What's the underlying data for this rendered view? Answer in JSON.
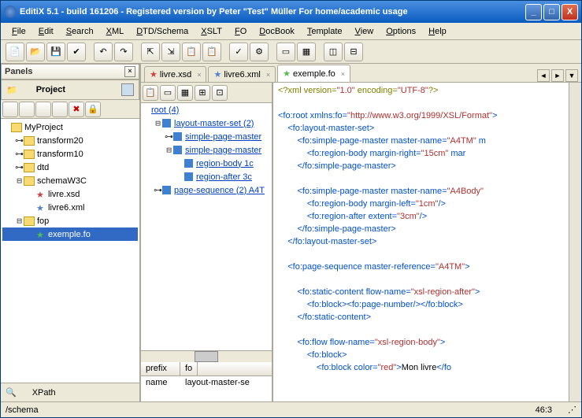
{
  "window": {
    "title": "EditiX 5.1 - build 161206 - Registered version by Peter \"Test\" Müller For home/academic usage"
  },
  "menu": [
    "File",
    "Edit",
    "Search",
    "XML",
    "DTD/Schema",
    "XSLT",
    "FO",
    "DocBook",
    "Template",
    "View",
    "Options",
    "Help"
  ],
  "panels_label": "Panels",
  "project": {
    "title": "Project",
    "tree": [
      {
        "name": "MyProject",
        "depth": 0,
        "type": "folder",
        "toggle": ""
      },
      {
        "name": "transform20",
        "depth": 1,
        "type": "folder",
        "toggle": "⊶"
      },
      {
        "name": "transform10",
        "depth": 1,
        "type": "folder",
        "toggle": "⊶"
      },
      {
        "name": "dtd",
        "depth": 1,
        "type": "folder",
        "toggle": "⊶"
      },
      {
        "name": "schemaW3C",
        "depth": 1,
        "type": "folder",
        "toggle": "⊟"
      },
      {
        "name": "livre.xsd",
        "depth": 2,
        "type": "file",
        "star": "red"
      },
      {
        "name": "livre6.xml",
        "depth": 2,
        "type": "file",
        "star": "blue"
      },
      {
        "name": "fop",
        "depth": 1,
        "type": "folder",
        "toggle": "⊟"
      },
      {
        "name": "exemple.fo",
        "depth": 2,
        "type": "file",
        "star": "green",
        "sel": true
      }
    ]
  },
  "xpath_label": "XPath",
  "tabs": [
    {
      "label": "livre.xsd",
      "star": "red"
    },
    {
      "label": "livre6.xml",
      "star": "blue"
    },
    {
      "label": "exemple.fo",
      "star": "green",
      "active": true
    }
  ],
  "outline": [
    {
      "text": "root (4)",
      "depth": 0,
      "link": true
    },
    {
      "text": "layout-master-set (2)",
      "depth": 1,
      "box": true,
      "link": true,
      "toggle": "⊟"
    },
    {
      "text": "simple-page-master",
      "depth": 2,
      "box": true,
      "link": true,
      "toggle": "⊶"
    },
    {
      "text": "simple-page-master",
      "depth": 2,
      "box": true,
      "link": true,
      "toggle": "⊟"
    },
    {
      "text": "region-body  1c",
      "depth": 3,
      "box": true,
      "link": true
    },
    {
      "text": "region-after  3c",
      "depth": 3,
      "box": true,
      "link": true
    },
    {
      "text": "page-sequence (2)  A4T",
      "depth": 1,
      "box": true,
      "link": true,
      "toggle": "⊶"
    }
  ],
  "prefix_table": {
    "headers": [
      "prefix",
      "fo"
    ],
    "row": [
      "name",
      "layout-master-se"
    ]
  },
  "code_lines": [
    [
      {
        "c": "pi",
        "t": "<?xml version="
      },
      {
        "c": "attr",
        "t": "\"1.0\""
      },
      {
        "c": "pi",
        "t": " encoding="
      },
      {
        "c": "attr",
        "t": "\"UTF-8\""
      },
      {
        "c": "pi",
        "t": "?>"
      }
    ],
    [],
    [
      {
        "c": "tag",
        "t": "<fo:root xmlns:fo="
      },
      {
        "c": "attr",
        "t": "\"http://www.w3.org/1999/XSL/Format\""
      },
      {
        "c": "tag",
        "t": ">"
      }
    ],
    [
      {
        "c": "txt",
        "t": "    "
      },
      {
        "c": "tag",
        "t": "<fo:layout-master-set>"
      }
    ],
    [
      {
        "c": "txt",
        "t": "        "
      },
      {
        "c": "tag",
        "t": "<fo:simple-page-master master-name="
      },
      {
        "c": "attr",
        "t": "\"A4TM\""
      },
      {
        "c": "tag",
        "t": " m"
      }
    ],
    [
      {
        "c": "txt",
        "t": "            "
      },
      {
        "c": "tag",
        "t": "<fo:region-body margin-right="
      },
      {
        "c": "attr",
        "t": "\"15cm\""
      },
      {
        "c": "tag",
        "t": " mar"
      }
    ],
    [
      {
        "c": "txt",
        "t": "        "
      },
      {
        "c": "tag",
        "t": "</fo:simple-page-master>"
      }
    ],
    [],
    [
      {
        "c": "txt",
        "t": "        "
      },
      {
        "c": "tag",
        "t": "<fo:simple-page-master master-name="
      },
      {
        "c": "attr",
        "t": "\"A4Body\""
      }
    ],
    [
      {
        "c": "txt",
        "t": "            "
      },
      {
        "c": "tag",
        "t": "<fo:region-body margin-left="
      },
      {
        "c": "attr",
        "t": "\"1cm\""
      },
      {
        "c": "tag",
        "t": "/>"
      }
    ],
    [
      {
        "c": "txt",
        "t": "            "
      },
      {
        "c": "tag",
        "t": "<fo:region-after extent="
      },
      {
        "c": "attr",
        "t": "\"3cm\""
      },
      {
        "c": "tag",
        "t": "/>"
      }
    ],
    [
      {
        "c": "txt",
        "t": "        "
      },
      {
        "c": "tag",
        "t": "</fo:simple-page-master>"
      }
    ],
    [
      {
        "c": "txt",
        "t": "    "
      },
      {
        "c": "tag",
        "t": "</fo:layout-master-set>"
      }
    ],
    [],
    [
      {
        "c": "txt",
        "t": "    "
      },
      {
        "c": "tag",
        "t": "<fo:page-sequence master-reference="
      },
      {
        "c": "attr",
        "t": "\"A4TM\""
      },
      {
        "c": "tag",
        "t": ">"
      }
    ],
    [],
    [
      {
        "c": "txt",
        "t": "        "
      },
      {
        "c": "tag",
        "t": "<fo:static-content flow-name="
      },
      {
        "c": "attr",
        "t": "\"xsl-region-after\""
      },
      {
        "c": "tag",
        "t": ">"
      }
    ],
    [
      {
        "c": "txt",
        "t": "            "
      },
      {
        "c": "tag",
        "t": "<fo:block><fo:page-number/></fo:block>"
      }
    ],
    [
      {
        "c": "txt",
        "t": "        "
      },
      {
        "c": "tag",
        "t": "</fo:static-content>"
      }
    ],
    [],
    [
      {
        "c": "txt",
        "t": "        "
      },
      {
        "c": "tag",
        "t": "<fo:flow flow-name="
      },
      {
        "c": "attr",
        "t": "\"xsl-region-body\""
      },
      {
        "c": "tag",
        "t": ">"
      }
    ],
    [
      {
        "c": "txt",
        "t": "            "
      },
      {
        "c": "tag",
        "t": "<fo:block>"
      }
    ],
    [
      {
        "c": "txt",
        "t": "                "
      },
      {
        "c": "tag",
        "t": "<fo:block color="
      },
      {
        "c": "attr",
        "t": "\"red\""
      },
      {
        "c": "tag",
        "t": ">"
      },
      {
        "c": "txt",
        "t": "Mon livre"
      },
      {
        "c": "tag",
        "t": "</fo"
      }
    ]
  ],
  "status": {
    "left": "/schema",
    "right": "46:3"
  }
}
